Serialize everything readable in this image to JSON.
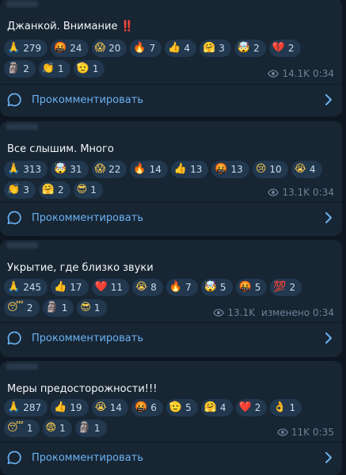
{
  "posts": [
    {
      "text": "Джанкой. Внимание ‼️",
      "reactions": [
        [
          {
            "emoji": "🙏",
            "count": "279"
          },
          {
            "emoji": "🤬",
            "count": "24"
          },
          {
            "emoji": "😱",
            "count": "20"
          },
          {
            "emoji": "🔥",
            "count": "7"
          },
          {
            "emoji": "👍",
            "count": "4"
          },
          {
            "emoji": "🤗",
            "count": "3"
          },
          {
            "emoji": "🤯",
            "count": "2"
          },
          {
            "emoji": "💔",
            "count": "2"
          }
        ],
        [
          {
            "emoji": "🗿",
            "count": "2"
          },
          {
            "emoji": "👏",
            "count": "1"
          },
          {
            "emoji": "🫡",
            "count": "1"
          }
        ]
      ],
      "views": "14.1K",
      "edited": "",
      "time": "0:34"
    },
    {
      "text": "Все слышим. Много",
      "reactions": [
        [
          {
            "emoji": "🙏",
            "count": "313"
          },
          {
            "emoji": "🤯",
            "count": "31"
          },
          {
            "emoji": "😱",
            "count": "22"
          },
          {
            "emoji": "🔥",
            "count": "14"
          },
          {
            "emoji": "👍",
            "count": "13"
          },
          {
            "emoji": "🤬",
            "count": "13"
          },
          {
            "emoji": "😢",
            "count": "10"
          },
          {
            "emoji": "😭",
            "count": "4"
          }
        ],
        [
          {
            "emoji": "👏",
            "count": "3"
          },
          {
            "emoji": "🤗",
            "count": "2"
          },
          {
            "emoji": "😎",
            "count": "1"
          }
        ]
      ],
      "views": "13.1K",
      "edited": "",
      "time": "0:34"
    },
    {
      "text": "Укрытие, где близко звуки",
      "reactions": [
        [
          {
            "emoji": "🙏",
            "count": "245"
          },
          {
            "emoji": "👍",
            "count": "17"
          },
          {
            "emoji": "❤️",
            "count": "11"
          },
          {
            "emoji": "😭",
            "count": "8"
          },
          {
            "emoji": "🔥",
            "count": "7"
          },
          {
            "emoji": "🤯",
            "count": "5"
          },
          {
            "emoji": "🤬",
            "count": "5"
          },
          {
            "emoji": "💯",
            "count": "2"
          }
        ],
        [
          {
            "emoji": "😴",
            "count": "2"
          },
          {
            "emoji": "🗿",
            "count": "1"
          },
          {
            "emoji": "😎",
            "count": "1"
          }
        ]
      ],
      "views": "13.1K",
      "edited": "изменено",
      "time": "0:34"
    },
    {
      "text": "Меры предосторожности!!!",
      "reactions": [
        [
          {
            "emoji": "🙏",
            "count": "287"
          },
          {
            "emoji": "👍",
            "count": "19"
          },
          {
            "emoji": "😭",
            "count": "14"
          },
          {
            "emoji": "🤬",
            "count": "6"
          },
          {
            "emoji": "🫡",
            "count": "5"
          },
          {
            "emoji": "🤗",
            "count": "4"
          },
          {
            "emoji": "❤️",
            "count": "2"
          },
          {
            "emoji": "👌",
            "count": "1"
          }
        ],
        [
          {
            "emoji": "😴",
            "count": "1"
          },
          {
            "emoji": "😨",
            "count": "1"
          },
          {
            "emoji": "🗿",
            "count": "1"
          }
        ]
      ],
      "views": "11K",
      "edited": "",
      "time": "0:35"
    }
  ],
  "comment_label": "Прокомментировать",
  "colors": {
    "background": "#0e1621",
    "bubble": "#182533",
    "pill": "#21384f",
    "accent": "#6ab3f3",
    "meta": "#6d8296"
  }
}
